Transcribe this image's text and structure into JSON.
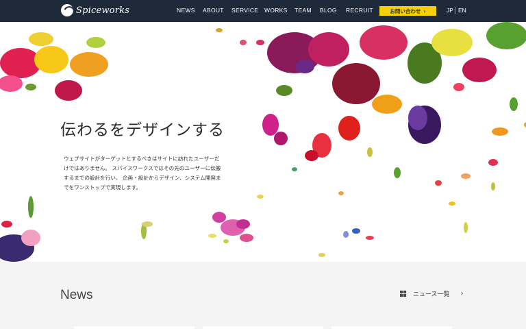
{
  "header": {
    "logo_text": "Spiceworks",
    "nav": [
      {
        "label": "NEWS"
      },
      {
        "label": "ABOUT"
      },
      {
        "label": "SERVICE"
      },
      {
        "label": "WORKS"
      },
      {
        "label": "TEAM"
      },
      {
        "label": "BLOG"
      },
      {
        "label": "RECRUIT"
      }
    ],
    "contact_label": "お問い合わせ",
    "contact_arrow": "›",
    "lang_jp": "JP",
    "lang_en": "EN",
    "colors": {
      "bar": "#1e2a3a",
      "accent": "#f7d000"
    }
  },
  "hero": {
    "title": "伝わるをデザインする",
    "body_lines": [
      "ウェブサイトがターゲットとするべきはサイトに訪れたユーザーだ",
      "けではありません。 スパイスワークスではその先のユーザーに伝搬",
      "するまでの設計を行い、 企画・設計からデザイン、システム開発ま",
      "でをワンストップで実現します。"
    ],
    "image": "flower-petals-illustration"
  },
  "news": {
    "title": "News",
    "list_link": "ニュース一覧",
    "list_icon": "grid-icon",
    "chevron_icon": "chevron-right-icon"
  }
}
